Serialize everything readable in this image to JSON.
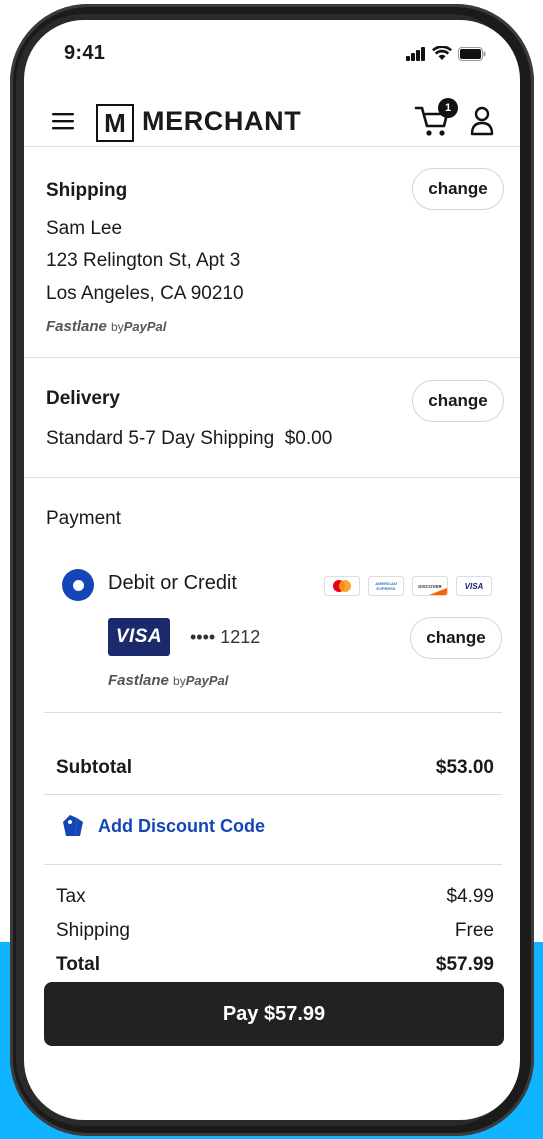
{
  "status_bar": {
    "time": "9:41"
  },
  "header": {
    "logo_letter": "M",
    "logo_text": "MERCHANT",
    "cart_count": "1"
  },
  "shipping": {
    "title": "Shipping",
    "change_label": "change",
    "name": "Sam Lee",
    "address_line1": "123 Relington St, Apt 3",
    "address_line2": "Los Angeles, CA 90210",
    "fastlane": {
      "brand": "Fastlane",
      "by": "by",
      "paypal": "PayPal"
    }
  },
  "delivery": {
    "title": "Delivery",
    "change_label": "change",
    "method": "Standard 5-7 Day Shipping",
    "price": "$0.00"
  },
  "payment": {
    "title": "Payment",
    "option_label": "Debit or Credit",
    "card_brands": [
      {
        "name": "mastercard",
        "color": "#eb001b"
      },
      {
        "label": "AMERICAN EXPRESS",
        "color": "#2e77bc"
      },
      {
        "label": "DISCOVER",
        "color": "#ff6000"
      },
      {
        "label": "VISA",
        "color": "#1a1f71"
      }
    ],
    "card_brand_badge": "VISA",
    "masked_number": "•••• 1212",
    "change_label": "change",
    "fastlane": {
      "brand": "Fastlane",
      "by": "by",
      "paypal": "PayPal"
    }
  },
  "summary": {
    "subtotal_label": "Subtotal",
    "subtotal_value": "$53.00",
    "discount_label": "Add Discount Code",
    "tax_label": "Tax",
    "tax_value": "$4.99",
    "shipping_label": "Shipping",
    "shipping_value": "Free",
    "total_label": "Total",
    "total_value": "$57.99"
  },
  "pay_button": {
    "label": "Pay $57.99"
  },
  "colors": {
    "accent": "#1446b8",
    "button": "#222222",
    "background_accent": "#0fb3ff"
  }
}
